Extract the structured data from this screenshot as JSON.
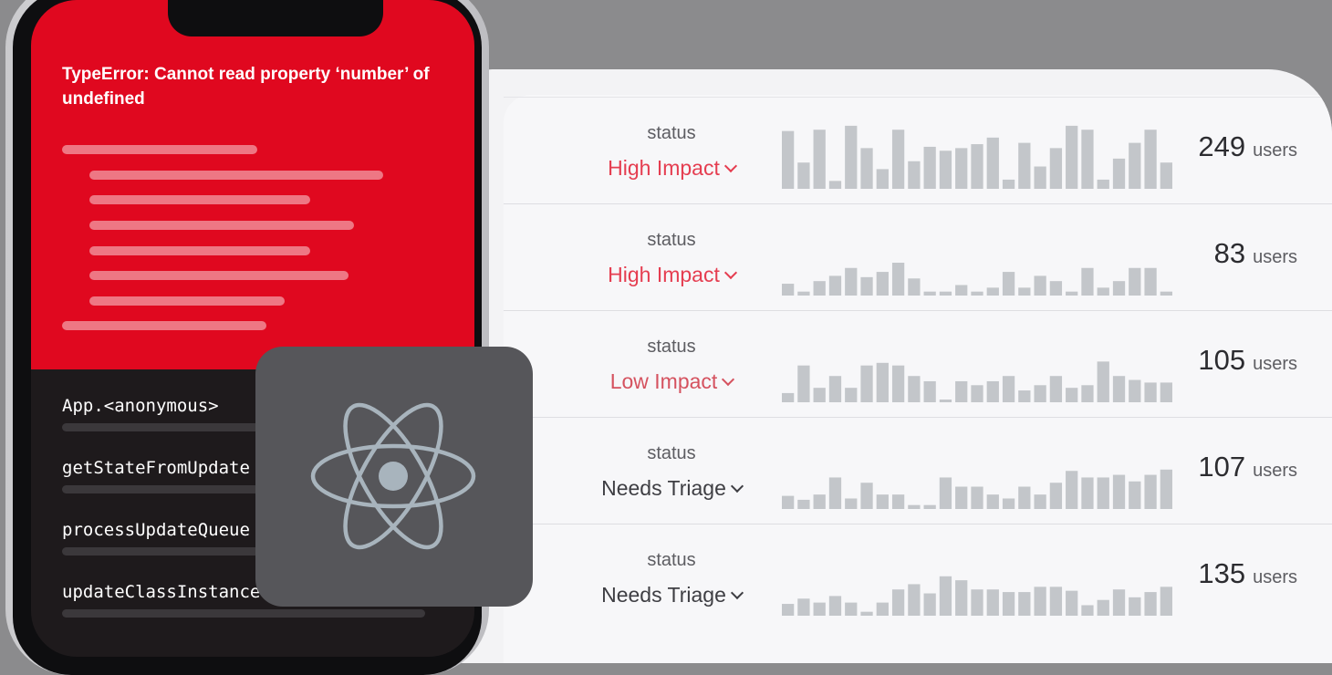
{
  "error": {
    "title": "TypeError: Cannot read property ‘number’ of undefined"
  },
  "stack_frames": [
    "App.<anonymous>",
    "getStateFromUpdate",
    "processUpdateQueue",
    "updateClassInstance"
  ],
  "icons": {
    "framework": "react-icon",
    "status_dropdown": "chevron-down-icon"
  },
  "colors": {
    "error_red": "#e0081f",
    "high_impact": "#e53d50",
    "low_impact": "#d5525f",
    "needs_triage": "#3e3e43",
    "sparkline_bar": "#c3c6ca"
  },
  "issues": [
    {
      "status_label": "status",
      "status": "High Impact",
      "count": "249",
      "unit": "users",
      "trend": [
        0.88,
        0.4,
        0.9,
        0.12,
        0.96,
        0.62,
        0.3,
        0.9,
        0.42,
        0.64,
        0.58,
        0.62,
        0.68,
        0.78,
        0.14,
        0.7,
        0.34,
        0.62,
        0.96,
        0.9,
        0.14,
        0.46,
        0.7,
        0.9,
        0.4
      ]
    },
    {
      "status_label": "status",
      "status": "High Impact",
      "count": "83",
      "unit": "users",
      "trend": [
        0.18,
        0.06,
        0.22,
        0.3,
        0.42,
        0.28,
        0.36,
        0.5,
        0.26,
        0.06,
        0.06,
        0.16,
        0.06,
        0.12,
        0.36,
        0.12,
        0.3,
        0.22,
        0.06,
        0.42,
        0.12,
        0.22,
        0.42,
        0.42,
        0.06
      ]
    },
    {
      "status_label": "status",
      "status": "Low Impact",
      "count": "105",
      "unit": "users",
      "trend": [
        0.14,
        0.56,
        0.22,
        0.4,
        0.22,
        0.56,
        0.6,
        0.56,
        0.4,
        0.32,
        0.04,
        0.32,
        0.26,
        0.32,
        0.4,
        0.18,
        0.26,
        0.4,
        0.22,
        0.26,
        0.62,
        0.4,
        0.34,
        0.3,
        0.3
      ]
    },
    {
      "status_label": "status",
      "status": "Needs Triage",
      "count": "107",
      "unit": "users",
      "trend": [
        0.2,
        0.14,
        0.22,
        0.48,
        0.16,
        0.4,
        0.22,
        0.22,
        0.06,
        0.06,
        0.48,
        0.34,
        0.34,
        0.22,
        0.16,
        0.34,
        0.22,
        0.4,
        0.58,
        0.48,
        0.48,
        0.52,
        0.42,
        0.52,
        0.6
      ]
    },
    {
      "status_label": "status",
      "status": "Needs Triage",
      "count": "135",
      "unit": "users",
      "trend": [
        0.18,
        0.26,
        0.2,
        0.3,
        0.2,
        0.06,
        0.2,
        0.4,
        0.48,
        0.34,
        0.6,
        0.54,
        0.4,
        0.4,
        0.36,
        0.36,
        0.44,
        0.44,
        0.38,
        0.16,
        0.24,
        0.4,
        0.28,
        0.36,
        0.44
      ]
    }
  ]
}
